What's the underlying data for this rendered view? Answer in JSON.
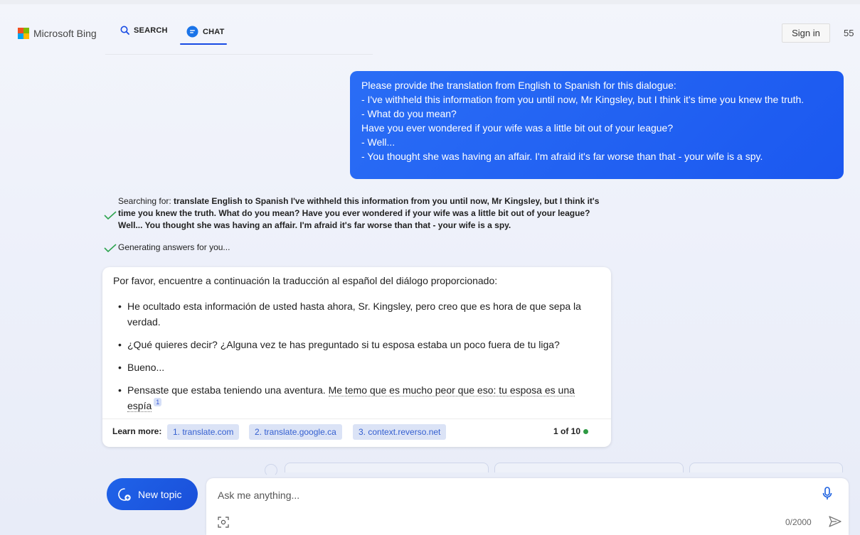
{
  "header": {
    "brand": "Microsoft Bing",
    "nav": [
      {
        "label": "SEARCH",
        "icon": "search-icon"
      },
      {
        "label": "CHAT",
        "icon": "chat-icon",
        "active": true
      }
    ],
    "sign_in": "Sign in",
    "points": "55"
  },
  "user_message": {
    "lines": [
      "Please provide the translation from English to Spanish for this dialogue:",
      "- I've withheld this information from you until now, Mr Kingsley, but I think it's time you knew the truth.",
      "- What do you mean?",
      "Have you ever wondered if your wife was a little bit out of your league?",
      "- Well...",
      "- You thought she was having an affair. I'm afraid it's far worse than that - your wife is a spy."
    ]
  },
  "progress": {
    "searching_prefix": "Searching for: ",
    "searching_query": "translate English to Spanish I've withheld this information from you until now, Mr Kingsley, but I think it's time you knew the truth. What do you mean? Have you ever wondered if your wife was a little bit out of your league? Well... You thought she was having an affair. I'm afraid it's far worse than that - your wife is a spy.",
    "generating": "Generating answers for you..."
  },
  "answer": {
    "intro": "Por favor, encuentre a continuación la traducción al español del diálogo proporcionado:",
    "items": [
      "He ocultado esta información de usted hasta ahora, Sr. Kingsley, pero creo que es hora de que sepa la verdad.",
      "¿Qué quieres decir? ¿Alguna vez te has preguntado si tu esposa estaba un poco fuera de tu liga?",
      "Bueno...",
      "Pensaste que estaba teniendo una aventura. "
    ],
    "last_item_cited": "Me temo que es mucho peor que eso: tu esposa es una espía",
    "citation": "1",
    "learn_more_label": "Learn more:",
    "sources": [
      "1. translate.com",
      "2. translate.google.ca",
      "3. context.reverso.net"
    ],
    "counter": "1 of 10"
  },
  "composer": {
    "new_topic": "New topic",
    "placeholder": "Ask me anything...",
    "char_count": "0/2000"
  },
  "colors": {
    "accent": "#1b58f0",
    "status_dot": "#2e9a43",
    "check": "#2ea44f"
  }
}
